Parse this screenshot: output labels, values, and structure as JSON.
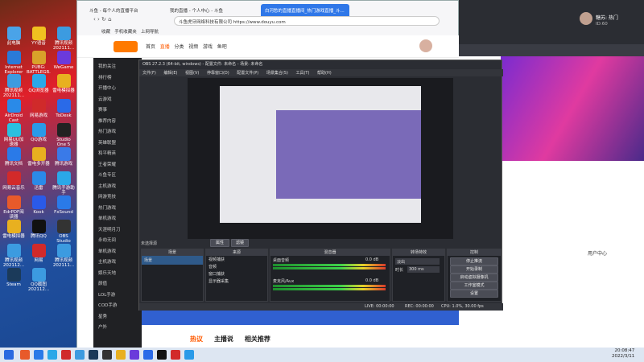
{
  "desktop": {
    "icons": [
      {
        "label": "此电脑",
        "color": "#4aa3e8"
      },
      {
        "label": "YY语音",
        "color": "#f0c020"
      },
      {
        "label": "腾讯视频202111...",
        "color": "#3c9be0"
      },
      {
        "label": "Internet Explorer",
        "color": "#2a7ad8"
      },
      {
        "label": "PUBG: BATTLEGR...",
        "color": "#d9a22a"
      },
      {
        "label": "WeGame",
        "color": "#6b3adb"
      },
      {
        "label": "腾讯视频202111...",
        "color": "#3c9be0"
      },
      {
        "label": "QQ浏览器",
        "color": "#2aa8e8"
      },
      {
        "label": "雷电模拟器",
        "color": "#e8b020"
      },
      {
        "label": "AirDroid Cast",
        "color": "#2a8ae8"
      },
      {
        "label": "网易游戏",
        "color": "#d02a2a"
      },
      {
        "label": "ToDesk",
        "color": "#2a6ae8"
      },
      {
        "label": "网易UU加速器",
        "color": "#2ac0e0"
      },
      {
        "label": "QQ游戏",
        "color": "#2a9ae8"
      },
      {
        "label": "Studio One 5",
        "color": "#222"
      },
      {
        "label": "腾讯文档",
        "color": "#2a7ae8"
      },
      {
        "label": "雷电多开器",
        "color": "#e8b020"
      },
      {
        "label": "腾讯游戏",
        "color": "#3a7ae8"
      },
      {
        "label": "网易云音乐",
        "color": "#d22a2a"
      },
      {
        "label": "迅雷",
        "color": "#2a8ae8"
      },
      {
        "label": "腾讯手游助手",
        "color": "#2aa8e8"
      },
      {
        "label": "EdrPDF阅读器",
        "color": "#e85a2a"
      },
      {
        "label": "Kook",
        "color": "#2a5ae8"
      },
      {
        "label": "FxSound",
        "color": "#2a7ae8"
      },
      {
        "label": "雷电模拟器",
        "color": "#e8b020"
      },
      {
        "label": "腾讯QQ",
        "color": "#111"
      },
      {
        "label": "OBS Studio",
        "color": "#333"
      },
      {
        "label": "腾讯视频202112...",
        "color": "#3c9be0"
      },
      {
        "label": "网易",
        "color": "#d02a2a"
      },
      {
        "label": "腾讯视频202111...",
        "color": "#3c9be0"
      },
      {
        "label": "Steam",
        "color": "#1b3a5a"
      },
      {
        "label": "QQ截图202112...",
        "color": "#3c9be0"
      }
    ]
  },
  "browser": {
    "tabs": [
      "斗鱼 - 每个人的直播平台",
      "我的直播 - 个人中心 - 斗鱼",
      "白河愁的直播直播间_热门游戏直播_斗..."
    ],
    "address": "斗鱼虎牙网络科技有限公司  https://www.douyu.com",
    "bookmarks": [
      "收藏",
      "手机收藏夹",
      "上网导航"
    ],
    "nav": [
      "首页",
      "直播",
      "分类",
      "视频",
      "游戏",
      "鱼吧"
    ],
    "sidenav": [
      "我的关注",
      "排行榜",
      "开播中心",
      "云游戏",
      "赛事",
      "推荐内容",
      "热门游戏",
      "英雄联盟",
      "和平精英",
      "王者荣耀",
      "斗鱼专区",
      "主机游戏",
      "网游竞技",
      "热门游戏",
      "单机游戏",
      "天涯明月刀",
      "永劫无间",
      "单机游戏",
      "主机游戏",
      "娱乐天地",
      "颜值",
      "LOL手游",
      "COD手游",
      "星秀",
      "户外"
    ],
    "footer": [
      "热议",
      "主播说",
      "相关推荐"
    ]
  },
  "obs": {
    "title": "OBS 27.2.3 (64-bit, windows) - 配置文件: 未命名 - 场景: 未命名",
    "menu": [
      "文件(F)",
      "编辑(E)",
      "视图(V)",
      "停靠窗口(D)",
      "配置文件(P)",
      "场景集合(S)",
      "工具(T)",
      "帮助(H)"
    ],
    "status_left": "未选择源",
    "props_btn": "属性",
    "filters_btn": "滤镜",
    "docks": [
      "场景",
      "来源",
      "混音器",
      "转场特效",
      "控制"
    ],
    "scenes": [
      "场景"
    ],
    "sources": [
      "视频捕获",
      "音频",
      "窗口捕获",
      "显示器采集"
    ],
    "mixer": [
      {
        "name": "桌面音频",
        "db": "0.0 dB"
      },
      {
        "name": "麦克风/Aux",
        "db": "0.0 dB"
      }
    ],
    "transition": {
      "type": "淡出",
      "duration_label": "时长",
      "duration": "300 ms"
    },
    "controls": [
      "停止推流",
      "开始录制",
      "启动虚拟摄像机",
      "工作室模式",
      "设置",
      "退出"
    ],
    "statusbar": {
      "live": "LIVE: 00:00:00",
      "rec": "REC: 00:00:00",
      "cpu": "CPU: 1.0%, 30.00 fps"
    }
  },
  "right": {
    "user": "糖苏: 热门",
    "id": "ID:60",
    "center": "用户中心"
  },
  "taskbar": {
    "time": "20:08:47",
    "date": "2022/3/11"
  }
}
